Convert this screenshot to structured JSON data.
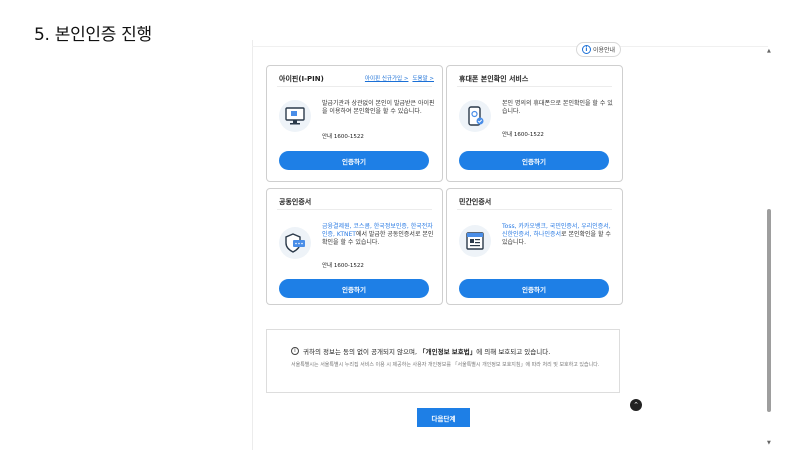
{
  "heading": "5. 본인인증 진행",
  "guide_button": "이용안내",
  "cards": {
    "ipin": {
      "title": "아이핀(I-PIN)",
      "link1": "아이핀 신규가입 >",
      "link2": "도움말 >",
      "desc": "발급기관과 상관없이 본인이 발급받은 아이핀을 이용하여 본인확인을 할 수 있습니다.",
      "tel": "안내 1600-1522",
      "button": "인증하기"
    },
    "phone": {
      "title": "휴대폰 본인확인 서비스",
      "desc": "본인 명의의 휴대폰으로 본인확인을 할 수 있습니다.",
      "tel": "안내 1600-1522",
      "button": "인증하기"
    },
    "cert": {
      "title": "공동인증서",
      "desc_blue": "금융결제원, 코스콤, 한국정보인증, 한국전자인증, KTNET",
      "desc_rest": "에서 발급한 공동인증서로 본인확인을 할 수 있습니다.",
      "tel": "안내 1600-1522",
      "button": "인증하기"
    },
    "private": {
      "title": "민간인증서",
      "desc_blue": "Toss, 카카오뱅크, 국민인증서, 우리인증서, 신한인증서, 하나인증서",
      "desc_rest": "로 본인확인을 할 수 있습니다.",
      "button": "인증하기"
    }
  },
  "notice": {
    "main_pre": "귀하의 정보는 동의 없이 공개되지 않으며, ",
    "main_bold": "「개인정보 보호법」",
    "main_post": "에 의해 보호되고 있습니다.",
    "sub": "서울특별시는 서울특별시 누리집 서비스 이용 시 제공하는 사용자 개인정보를 「서울특별시 개인정보 보호지침」에 따라 처리 및 보호하고 있습니다."
  },
  "next_button": "다음단계"
}
